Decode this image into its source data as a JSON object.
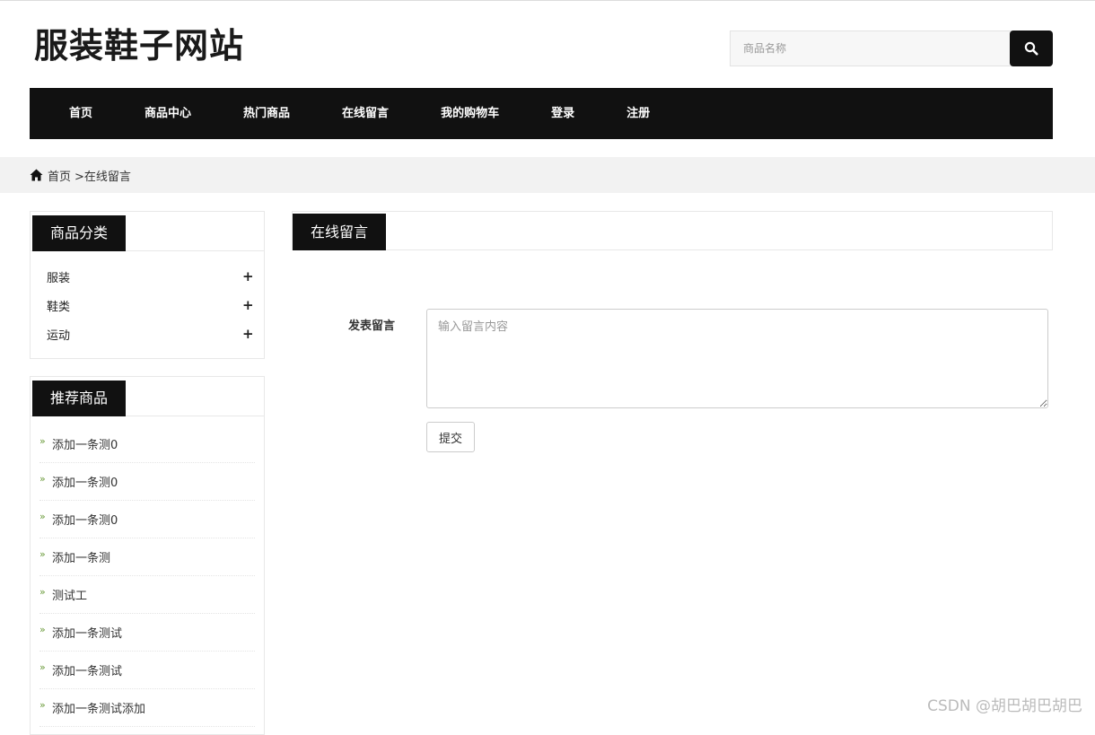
{
  "header": {
    "site_title": "服装鞋子网站",
    "search": {
      "placeholder": "商品名称",
      "value": ""
    }
  },
  "nav": {
    "items": [
      {
        "label": "首页"
      },
      {
        "label": "商品中心"
      },
      {
        "label": "热门商品"
      },
      {
        "label": "在线留言"
      },
      {
        "label": "我的购物车"
      },
      {
        "label": "登录"
      },
      {
        "label": "注册"
      }
    ]
  },
  "breadcrumb": {
    "home": "首页",
    "current": ">在线留言"
  },
  "sidebar": {
    "categories": {
      "title": "商品分类",
      "items": [
        {
          "label": "服装"
        },
        {
          "label": "鞋类"
        },
        {
          "label": "运动"
        }
      ]
    },
    "recommended": {
      "title": "推荐商品",
      "items": [
        {
          "label": "添加一条测0"
        },
        {
          "label": "添加一条测0"
        },
        {
          "label": "添加一条测0"
        },
        {
          "label": "添加一条测"
        },
        {
          "label": "测试工"
        },
        {
          "label": "添加一条测试"
        },
        {
          "label": "添加一条测试"
        },
        {
          "label": "添加一条测试添加"
        }
      ]
    }
  },
  "main": {
    "title": "在线留言",
    "form": {
      "label": "发表留言",
      "placeholder": "输入留言内容",
      "value": "",
      "submit_label": "提交"
    }
  },
  "watermark": "CSDN @胡巴胡巴胡巴",
  "icons": {
    "search": "search-icon",
    "home": "home-icon",
    "expand": "plus-icon",
    "bullet": "double-chevron-right-icon"
  },
  "colors": {
    "nav_bg": "#111111",
    "breadcrumb_bg": "#f2f2f2",
    "bullet": "#6a9a3a"
  }
}
